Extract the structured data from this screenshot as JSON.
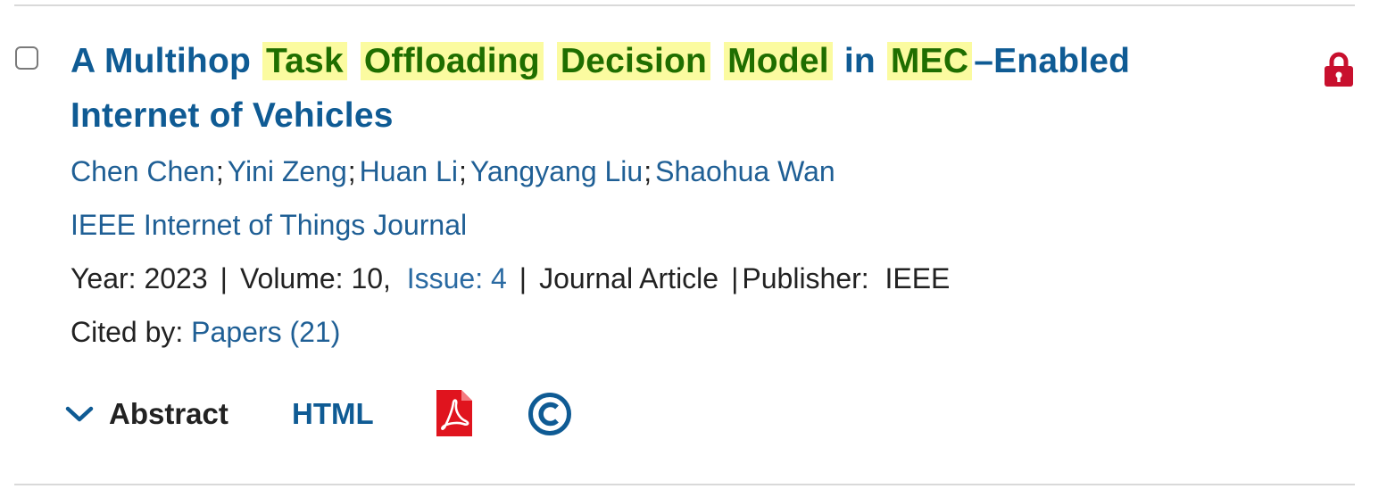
{
  "result": {
    "title_parts": [
      {
        "text": "A Multihop ",
        "highlight": false
      },
      {
        "text": "Task",
        "highlight": true
      },
      {
        "text": " ",
        "highlight": false
      },
      {
        "text": "Offloading",
        "highlight": true
      },
      {
        "text": " ",
        "highlight": false
      },
      {
        "text": "Decision",
        "highlight": true
      },
      {
        "text": " ",
        "highlight": false
      },
      {
        "text": "Model",
        "highlight": true
      },
      {
        "text": " in ",
        "highlight": false
      },
      {
        "text": "MEC",
        "highlight": true
      },
      {
        "text": "–Enabled Internet of Vehicles",
        "highlight": false
      }
    ],
    "authors": [
      "Chen Chen",
      "Yini Zeng",
      "Huan Li",
      "Yangyang Liu",
      "Shaohua Wan"
    ],
    "author_separator": ";",
    "journal": "IEEE Internet of Things Journal",
    "meta": {
      "year_label": "Year:",
      "year": "2023",
      "volume_label": "Volume:",
      "volume": "10,",
      "issue_link": "Issue: 4",
      "type": "Journal Article",
      "publisher_label": "Publisher:",
      "publisher": "IEEE",
      "divider": "|"
    },
    "cited": {
      "label": "Cited by:",
      "link": "Papers (21)"
    },
    "actions": {
      "abstract_label": "Abstract",
      "html_label": "HTML"
    },
    "icons": {
      "lock": "lock-icon",
      "chevron": "chevron-down-icon",
      "pdf": "pdf-icon",
      "rights": "copyright-icon"
    },
    "colors": {
      "title_link": "#0f5b94",
      "highlight_bg": "#fbfba0",
      "highlight_text": "#1f6e00",
      "link": "#1f5f95",
      "lock": "#c8102e",
      "pdf": "#e0141e"
    }
  }
}
